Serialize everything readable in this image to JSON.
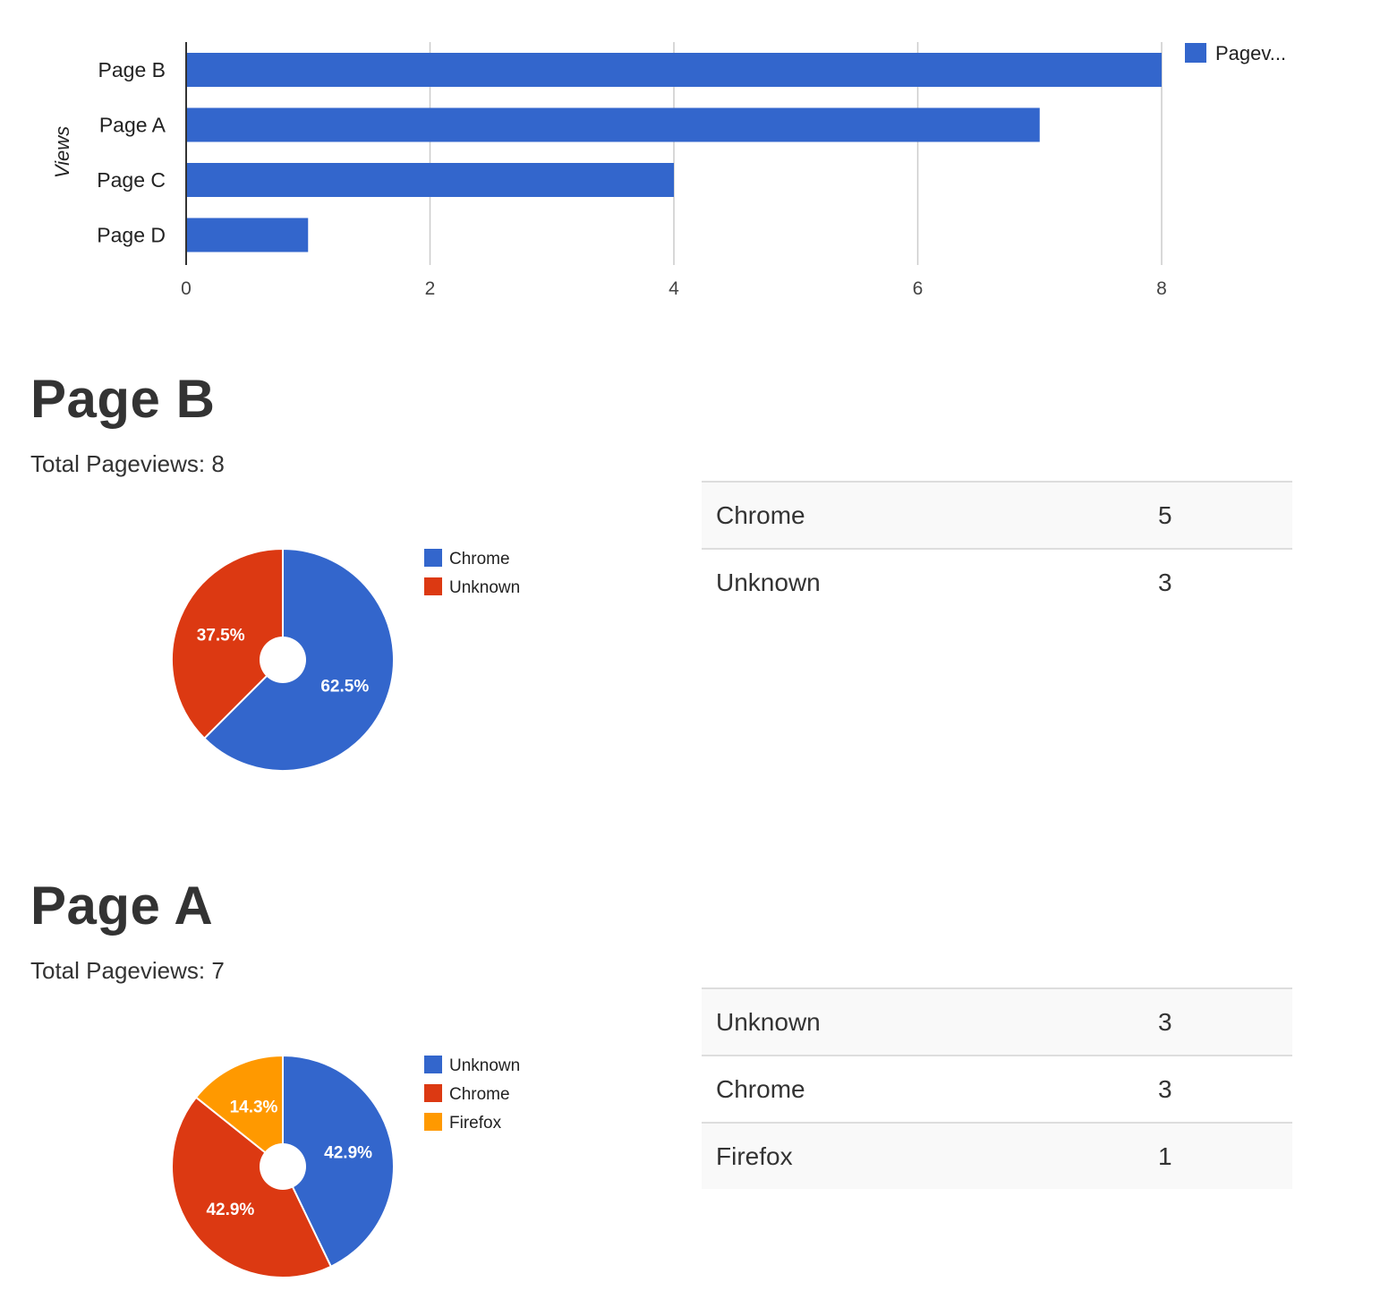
{
  "colors": {
    "blue": "#3366cc",
    "red": "#dc3912",
    "orange": "#ff9900",
    "grid": "#cccccc",
    "axis": "#333333"
  },
  "chart_data": [
    {
      "type": "bar",
      "orientation": "horizontal",
      "categories": [
        "Page B",
        "Page A",
        "Page C",
        "Page D"
      ],
      "series": [
        {
          "name": "Pagev...",
          "values": [
            8,
            7,
            4,
            1
          ]
        }
      ],
      "ylabel": "Views",
      "xlim": [
        0,
        9
      ],
      "xticks": [
        "0",
        "2",
        "4",
        "6",
        "8"
      ],
      "grid": true,
      "legend_position": "top-right"
    },
    {
      "type": "pie",
      "categories": [
        "Chrome",
        "Unknown"
      ],
      "values": [
        5,
        3
      ],
      "labels": [
        "62.5%",
        "37.5%"
      ],
      "colors": [
        "#3366cc",
        "#dc3912"
      ],
      "legend_position": "right"
    },
    {
      "type": "pie",
      "categories": [
        "Unknown",
        "Chrome",
        "Firefox"
      ],
      "values": [
        3,
        3,
        1
      ],
      "labels": [
        "42.9%",
        "42.9%",
        "14.3%"
      ],
      "colors": [
        "#3366cc",
        "#dc3912",
        "#ff9900"
      ],
      "legend_position": "right"
    }
  ],
  "sections": [
    {
      "title": "Page B",
      "total_line": "Total Pageviews: 8",
      "table": [
        {
          "name": "Chrome",
          "count": "5"
        },
        {
          "name": "Unknown",
          "count": "3"
        }
      ]
    },
    {
      "title": "Page A",
      "total_line": "Total Pageviews: 7",
      "table": [
        {
          "name": "Unknown",
          "count": "3"
        },
        {
          "name": "Chrome",
          "count": "3"
        },
        {
          "name": "Firefox",
          "count": "1"
        }
      ]
    }
  ]
}
